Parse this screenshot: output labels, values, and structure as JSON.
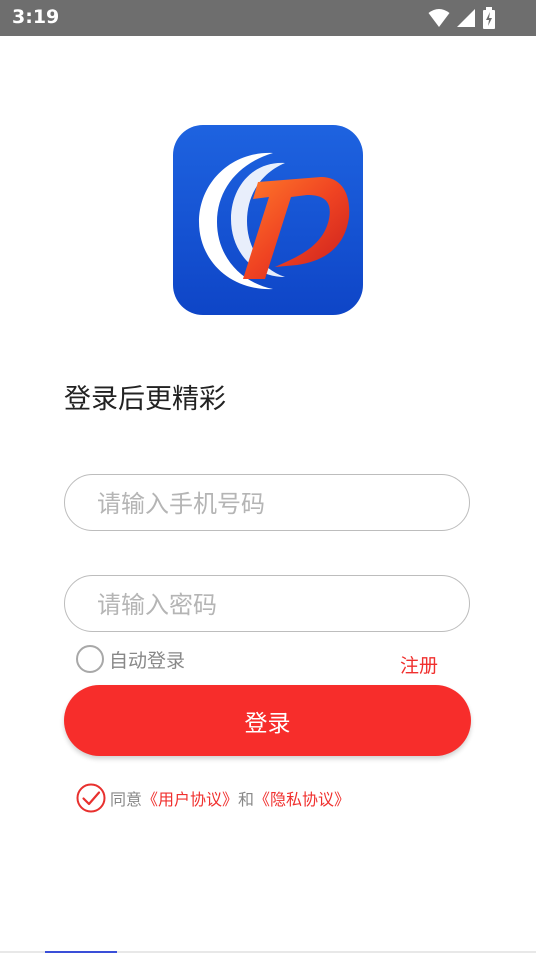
{
  "status_bar": {
    "time": "3:19"
  },
  "headline": "登录后更精彩",
  "phone_input": {
    "placeholder": "请输入手机号码",
    "value": ""
  },
  "password_input": {
    "placeholder": "请输入密码",
    "value": ""
  },
  "auto_login": {
    "label": "自动登录",
    "checked": false
  },
  "register_label": "注册",
  "login_button_label": "登录",
  "agreement": {
    "checked": true,
    "prefix": "同意",
    "user_agreement": "《用户协议》",
    "conjunction": "和",
    "privacy_policy": "《隐私协议》"
  },
  "colors": {
    "accent_red": "#f72d2b",
    "logo_blue": "#1a56d6",
    "status_bar": "#6e6e6e"
  },
  "icons": [
    "wifi-icon",
    "signal-icon",
    "battery-icon",
    "app-logo",
    "checkmark-icon"
  ]
}
